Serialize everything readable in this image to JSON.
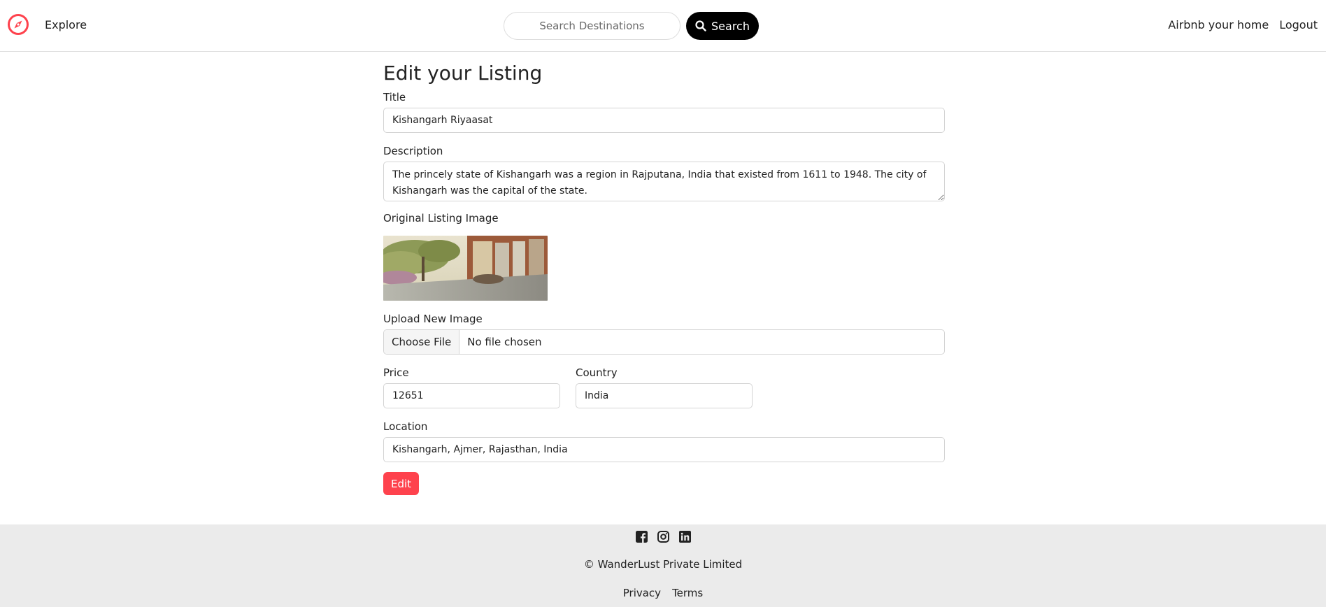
{
  "colors": {
    "brand": "#fe424d",
    "footer_bg": "#ebebeb",
    "search_button": "#000000"
  },
  "navbar": {
    "brand_icon": "compass-icon",
    "explore_label": "Explore",
    "search_placeholder": "Search Destinations",
    "search_button_label": "Search",
    "host_link": "Airbnb your home",
    "logout_link": "Logout"
  },
  "form": {
    "heading": "Edit your Listing",
    "title_label": "Title",
    "title_value": "Kishangarh Riyaasat",
    "description_label": "Description",
    "description_value": "The princely state of Kishangarh was a region in Rajputana, India that existed from 1611 to 1948. The city of Kishangarh was the capital of the state.",
    "original_image_label": "Original Listing Image",
    "upload_label": "Upload New Image",
    "choose_file_label": "Choose File",
    "file_status": "No file chosen",
    "price_label": "Price",
    "price_value": "12651",
    "country_label": "Country",
    "country_value": "India",
    "location_label": "Location",
    "location_value": "Kishangarh, Ajmer, Rajasthan, India",
    "submit_label": "Edit"
  },
  "footer": {
    "social_icons": [
      "facebook-icon",
      "instagram-icon",
      "linkedin-icon"
    ],
    "copyright": "© WanderLust Private Limited",
    "privacy_link": "Privacy",
    "terms_link": "Terms"
  }
}
